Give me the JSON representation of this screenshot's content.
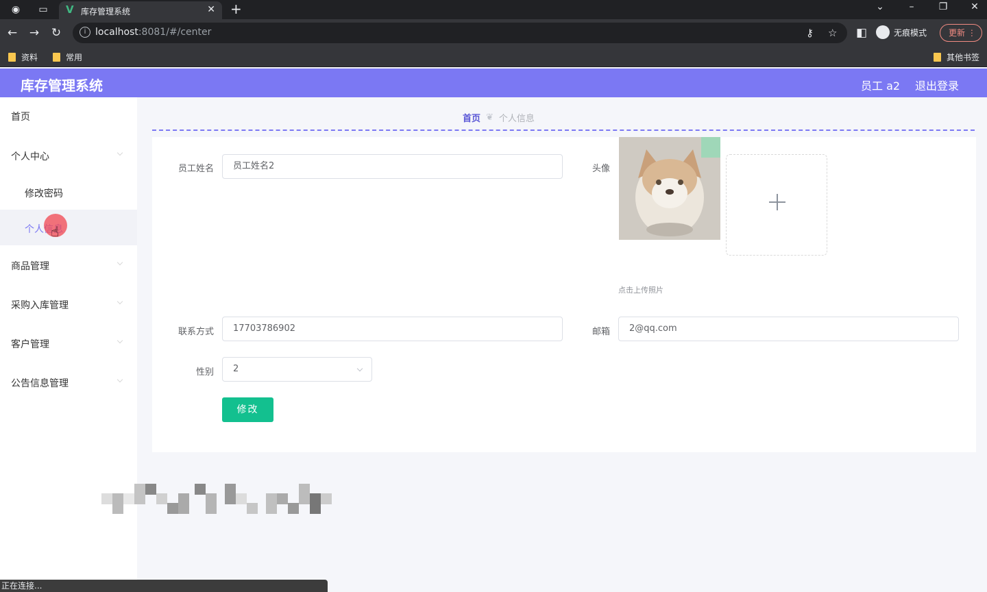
{
  "browser": {
    "tab_title": "库存管理系统",
    "url_host": "localhost",
    "url_rest": ":8081/#/center",
    "incognito_label": "无痕模式",
    "update_label": "更新",
    "bookmarks": [
      "资料",
      "常用"
    ],
    "other_bookmarks": "其他书签",
    "status_text": "正在连接..."
  },
  "header": {
    "app_title": "库存管理系统",
    "user_label": "员工 a2",
    "logout_label": "退出登录"
  },
  "sidebar": {
    "home": "首页",
    "personal_center": "个人中心",
    "change_password": "修改密码",
    "personal_info": "个人信息",
    "goods_management": "商品管理",
    "purchase_management": "采购入库管理",
    "customer_management": "客户管理",
    "notice_management": "公告信息管理"
  },
  "breadcrumb": {
    "home": "首页",
    "current": "个人信息"
  },
  "form": {
    "name_label": "员工姓名",
    "name_value": "员工姓名2",
    "avatar_label": "头像",
    "upload_tip": "点击上传照片",
    "phone_label": "联系方式",
    "phone_value": "17703786902",
    "email_label": "邮箱",
    "email_value": "2@qq.com",
    "gender_label": "性别",
    "gender_value": "2",
    "submit_label": "修改"
  },
  "icons": {
    "back": "arrow-left-icon",
    "forward": "arrow-right-icon",
    "reload": "reload-icon",
    "info": "info-icon",
    "key": "key-icon",
    "star": "star-icon",
    "sidepanel": "side-panel-icon",
    "plus": "plus-icon",
    "chevron": "chevron-down-icon"
  },
  "colors": {
    "accent": "#7b78f3",
    "submit": "#13c08f"
  }
}
